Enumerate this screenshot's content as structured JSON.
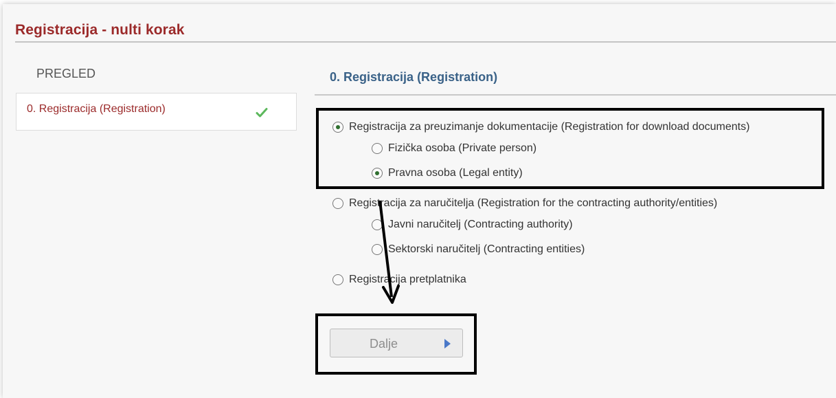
{
  "page": {
    "title": "Registracija - nulti korak"
  },
  "sidebar": {
    "title": "PREGLED",
    "items": [
      {
        "label": "0. Registracija (Registration)",
        "status_icon": "check-icon"
      }
    ]
  },
  "main": {
    "section_title": "0. Registracija (Registration)",
    "options": [
      {
        "label": "Registracija za preuzimanje dokumentacije (Registration for download documents)",
        "checked": true,
        "sub_options": [
          {
            "label": "Fizička osoba (Private person)",
            "checked": false
          },
          {
            "label": "Pravna osoba (Legal entity)",
            "checked": true
          }
        ]
      },
      {
        "label": "Registracija za naručitelja (Registration for the contracting authority/entities)",
        "checked": false,
        "sub_options": [
          {
            "label": "Javni naručitelj (Contracting authority)",
            "checked": false
          },
          {
            "label": "Sektorski naručitelj (Contracting entities)",
            "checked": false
          }
        ]
      },
      {
        "label": "Registracija pretplatnika",
        "checked": false,
        "sub_options": []
      }
    ],
    "next_button": {
      "label": "Dalje",
      "icon": "play-arrow-icon"
    }
  },
  "colors": {
    "title_red": "#9b2a2a",
    "section_blue": "#3a6288",
    "check_green": "#5cb85c",
    "button_arrow_blue": "#4a78c8",
    "annotation_black": "#000000"
  }
}
